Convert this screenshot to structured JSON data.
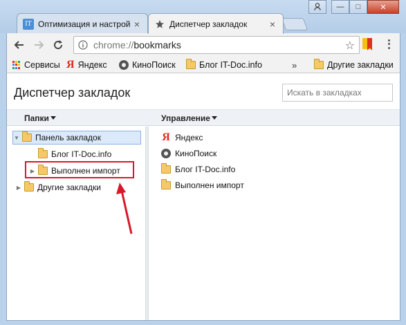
{
  "tabs": [
    {
      "title": "Оптимизация и настрой",
      "icon": "it-doc-icon",
      "close": "×"
    },
    {
      "title": "Диспетчер закладок",
      "icon": "star-icon",
      "close": "×"
    }
  ],
  "window_controls": {
    "user": "👤",
    "minimize": "—",
    "maximize": "□",
    "close": "✕"
  },
  "omnibox": {
    "scheme": "chrome://",
    "path": "bookmarks"
  },
  "bookmarks_bar": {
    "items": [
      {
        "label": "Сервисы",
        "icon": "apps-icon"
      },
      {
        "label": "Яндекс",
        "icon": "yandex-icon"
      },
      {
        "label": "КиноПоиск",
        "icon": "kinopoisk-icon"
      },
      {
        "label": "Блог IT-Doc.info",
        "icon": "folder-icon"
      }
    ],
    "overflow": "»",
    "other": "Другие закладки"
  },
  "page": {
    "title": "Диспетчер закладок",
    "search_placeholder": "Искать в закладках"
  },
  "columns": {
    "folders": "Папки",
    "manage": "Управление"
  },
  "tree": {
    "root": "Панель закладок",
    "children": [
      "Блог IT-Doc.info",
      "Выполнен импорт"
    ],
    "other": "Другие закладки"
  },
  "list": [
    {
      "label": "Яндекс",
      "icon": "yandex-icon"
    },
    {
      "label": "КиноПоиск",
      "icon": "kinopoisk-icon"
    },
    {
      "label": "Блог IT-Doc.info",
      "icon": "folder-icon"
    },
    {
      "label": "Выполнен импорт",
      "icon": "folder-icon"
    }
  ],
  "colors": {
    "highlight": "#d6182a",
    "selected_bg": "#dbe9f8",
    "folder": "#f5c966"
  }
}
